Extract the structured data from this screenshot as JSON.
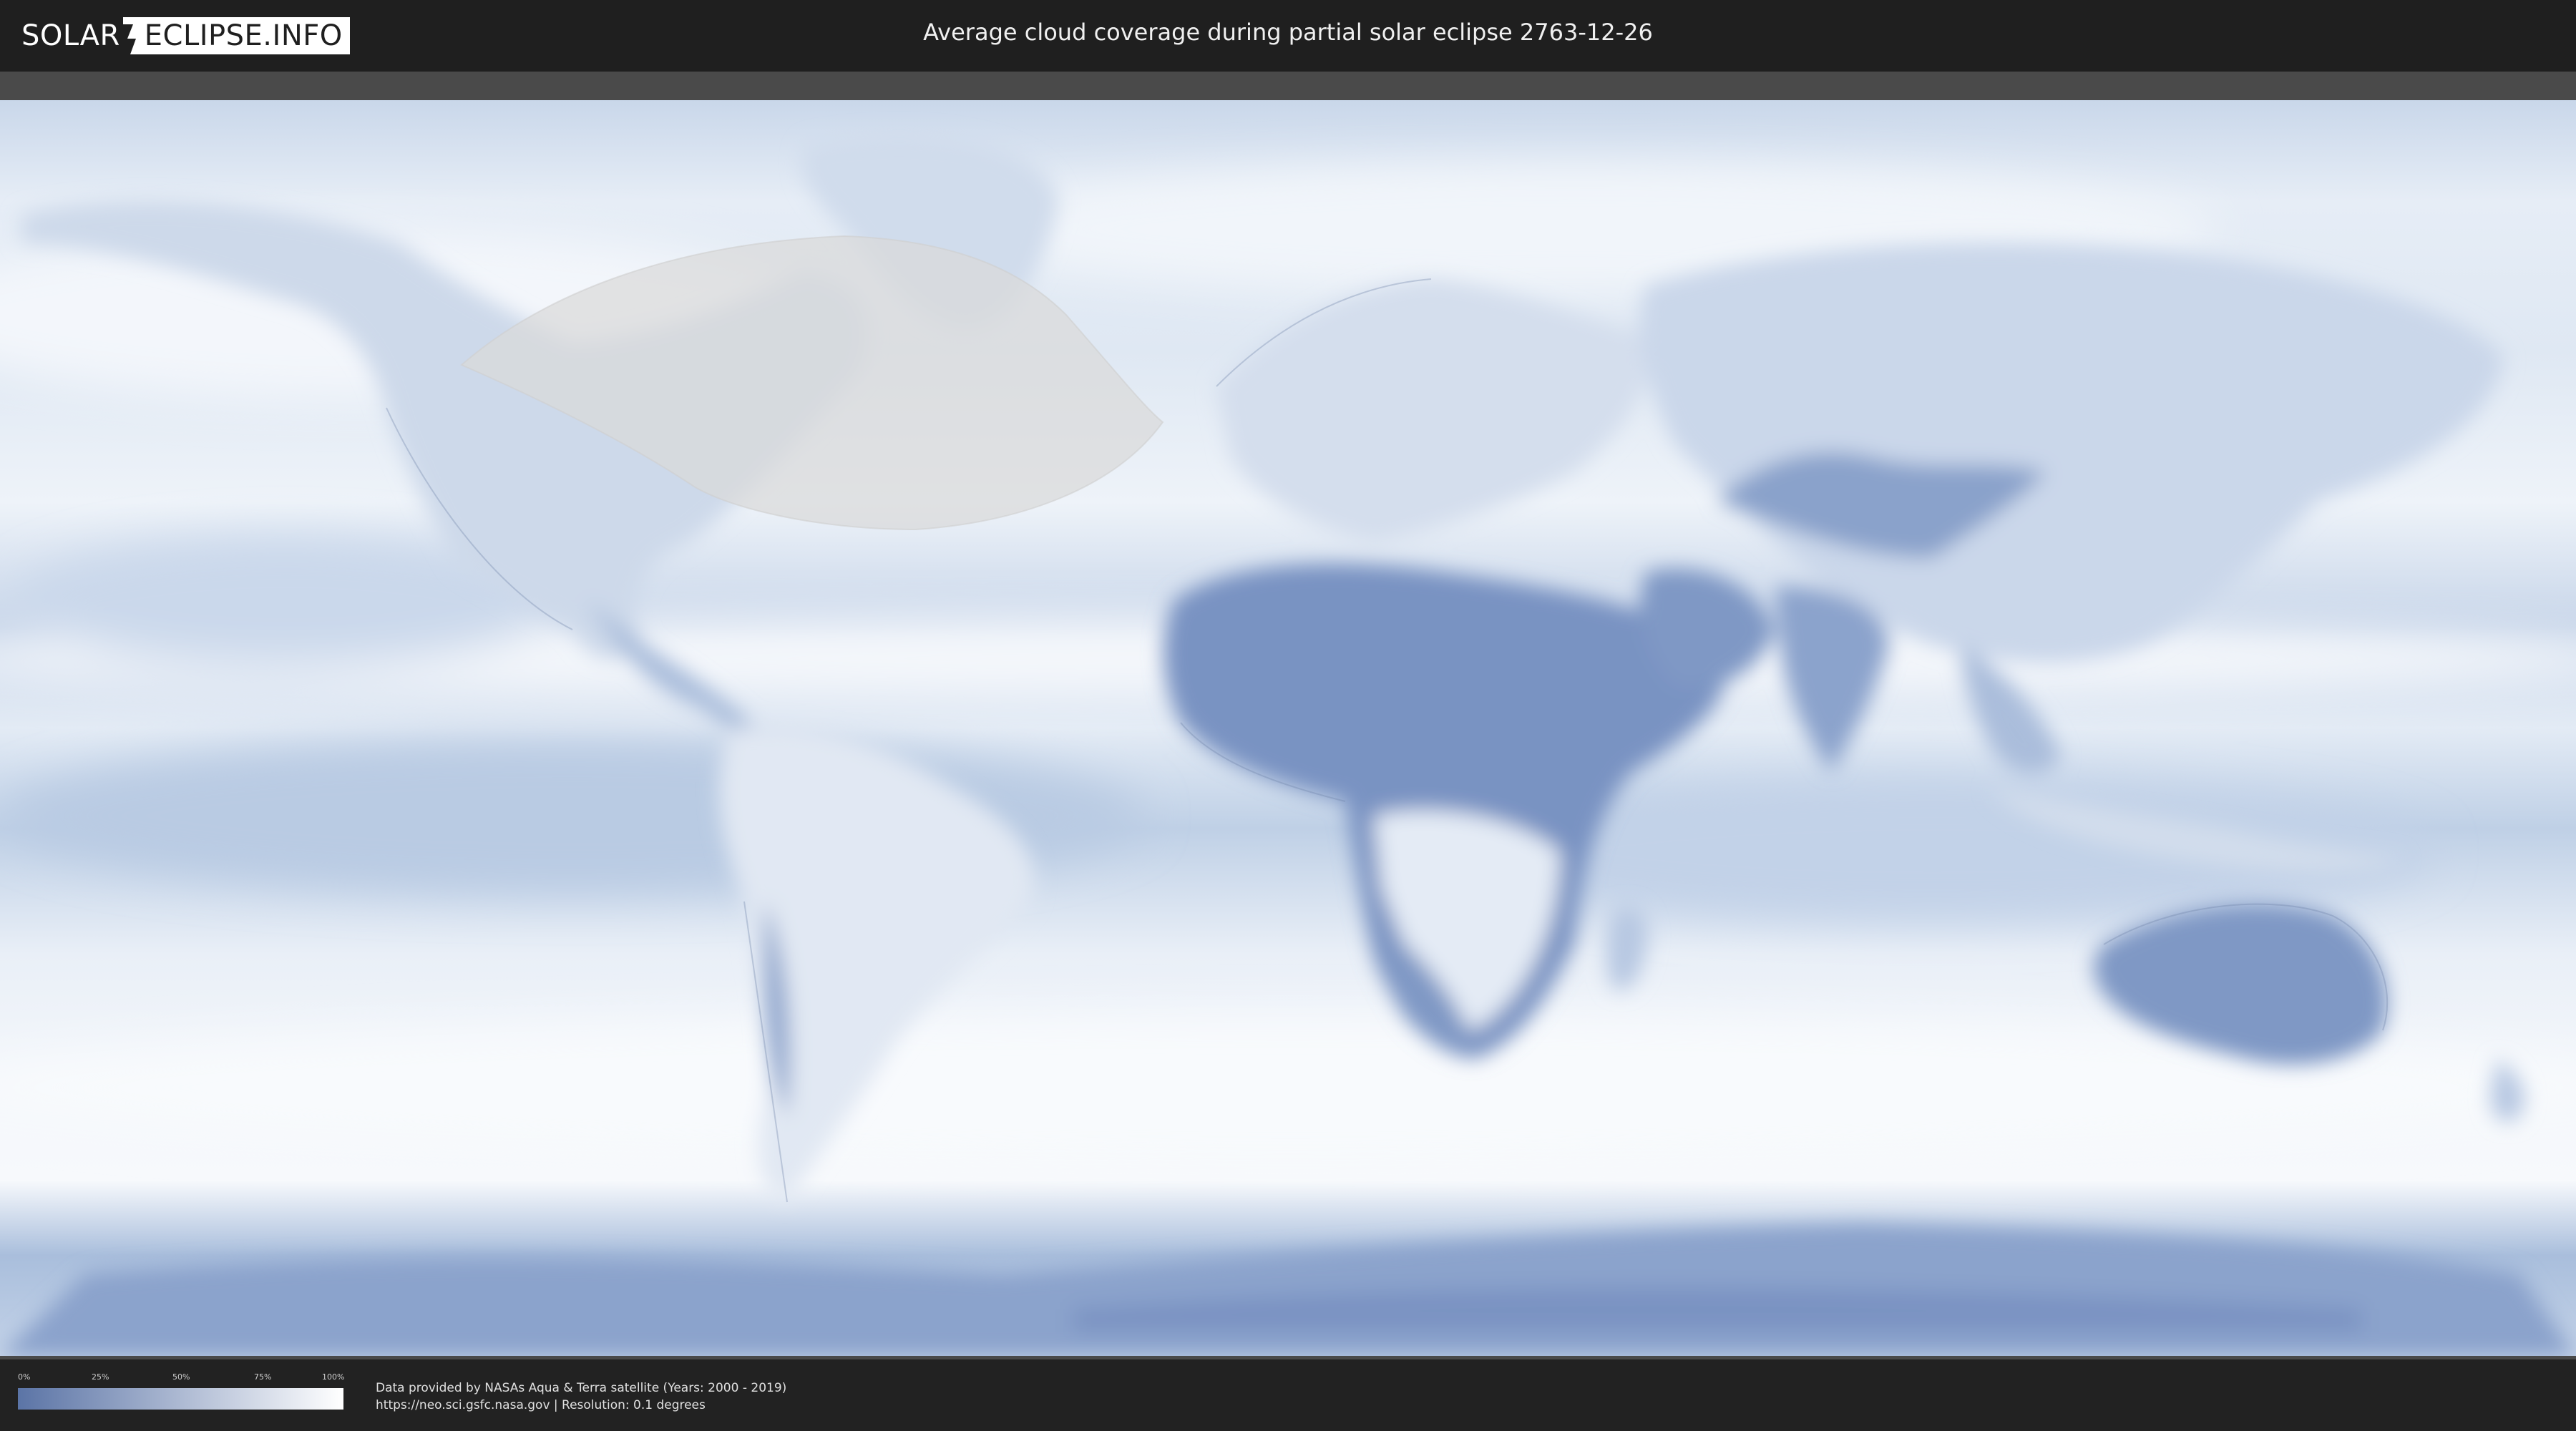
{
  "header": {
    "logo_left": "SOLAR",
    "logo_right": "ECLIPSE.INFO",
    "title": "Average cloud coverage during partial solar eclipse 2763-12-26"
  },
  "map": {
    "projection": "equirectangular world map",
    "eclipse_shadow": "partial eclipse visibility zone over North America and North Atlantic",
    "colors": {
      "clear": "#5b77a8",
      "cloudy": "#ffffff",
      "shadow_overlay": "#d9d9d9"
    }
  },
  "legend": {
    "ticks": [
      "0%",
      "25%",
      "50%",
      "75%",
      "100%"
    ],
    "gradient_start": "#5b74a6",
    "gradient_end": "#ffffff"
  },
  "credits": {
    "line1": "Data provided by NASAs Aqua & Terra satellite (Years: 2000 - 2019)",
    "line2": "https://neo.sci.gsfc.nasa.gov | Resolution: 0.1 degrees"
  }
}
